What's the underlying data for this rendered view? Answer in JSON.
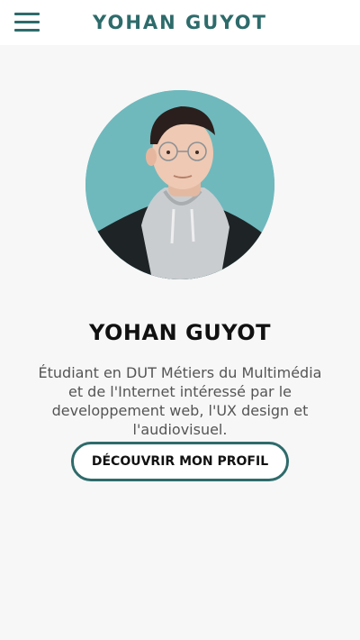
{
  "header": {
    "menu_icon": "hamburger-menu-icon",
    "brand": "YOHAN GUYOT"
  },
  "profile": {
    "photo_alt": "Photo de Yohan Guyot",
    "name": "YOHAN GUYOT",
    "bio": "Étudiant en DUT Métiers du Multimédia et de l'Internet intéressé par le developpement web, l'UX design et l'audiovisuel.",
    "cta_label": "DÉCOUVRIR MON PROFIL"
  },
  "colors": {
    "accent": "#2e6b6b",
    "background": "#f7f7f7",
    "header_background": "#ffffff",
    "photo_background": "#6fb9bd",
    "text_dark": "#111111",
    "text_body": "#555555"
  }
}
